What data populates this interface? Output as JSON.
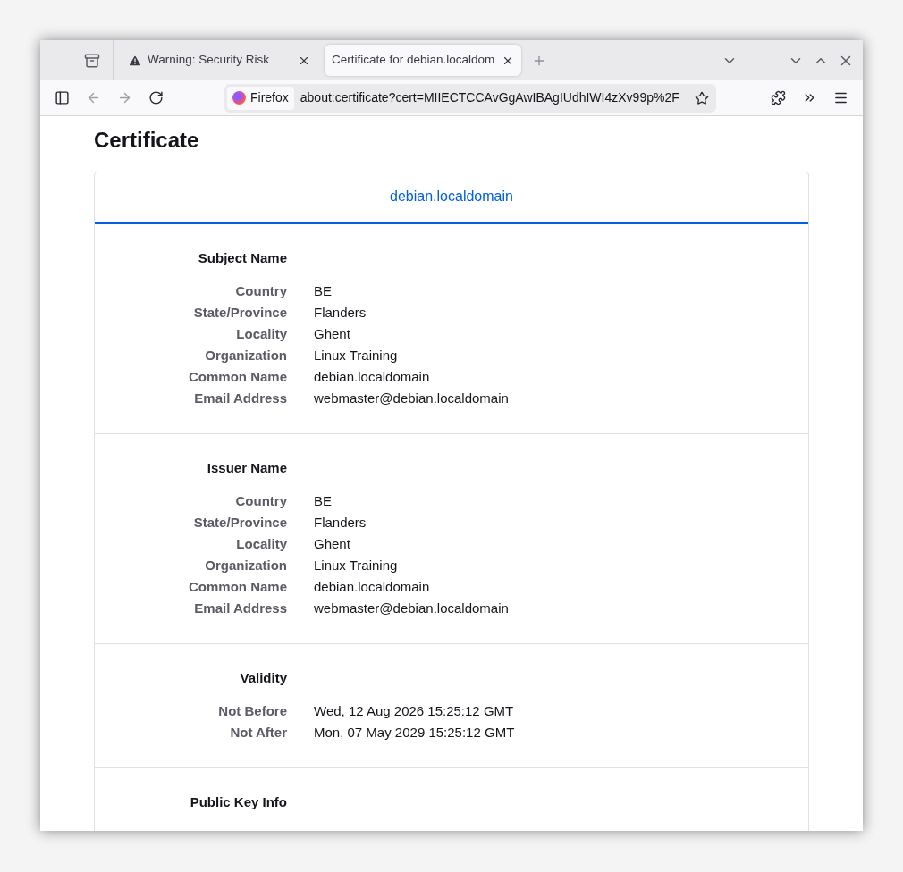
{
  "tabs": [
    {
      "title": "Warning: Security Risk",
      "kind": "warning",
      "selected": false
    },
    {
      "title": "Certificate for debian.localdom",
      "kind": "plain",
      "selected": true
    }
  ],
  "address_bar": {
    "identity": "Firefox",
    "url": "about:certificate?cert=MIIECTCCAvGgAwIBAgIUdhIWI4zXv99p%2F"
  },
  "page": {
    "heading": "Certificate",
    "card_title": "debian.localdomain",
    "sections": [
      {
        "title": "Subject Name",
        "rows": [
          {
            "label": "Country",
            "value": "BE"
          },
          {
            "label": "State/Province",
            "value": "Flanders"
          },
          {
            "label": "Locality",
            "value": "Ghent"
          },
          {
            "label": "Organization",
            "value": "Linux Training"
          },
          {
            "label": "Common Name",
            "value": "debian.localdomain"
          },
          {
            "label": "Email Address",
            "value": "webmaster@debian.localdomain"
          }
        ]
      },
      {
        "title": "Issuer Name",
        "rows": [
          {
            "label": "Country",
            "value": "BE"
          },
          {
            "label": "State/Province",
            "value": "Flanders"
          },
          {
            "label": "Locality",
            "value": "Ghent"
          },
          {
            "label": "Organization",
            "value": "Linux Training"
          },
          {
            "label": "Common Name",
            "value": "debian.localdomain"
          },
          {
            "label": "Email Address",
            "value": "webmaster@debian.localdomain"
          }
        ]
      },
      {
        "title": "Validity",
        "rows": [
          {
            "label": "Not Before",
            "value": "Wed, 12 Aug 2026 15:25:12 GMT"
          },
          {
            "label": "Not After",
            "value": "Mon, 07 May 2029 15:25:12 GMT"
          }
        ]
      },
      {
        "title": "Public Key Info"
      }
    ]
  }
}
